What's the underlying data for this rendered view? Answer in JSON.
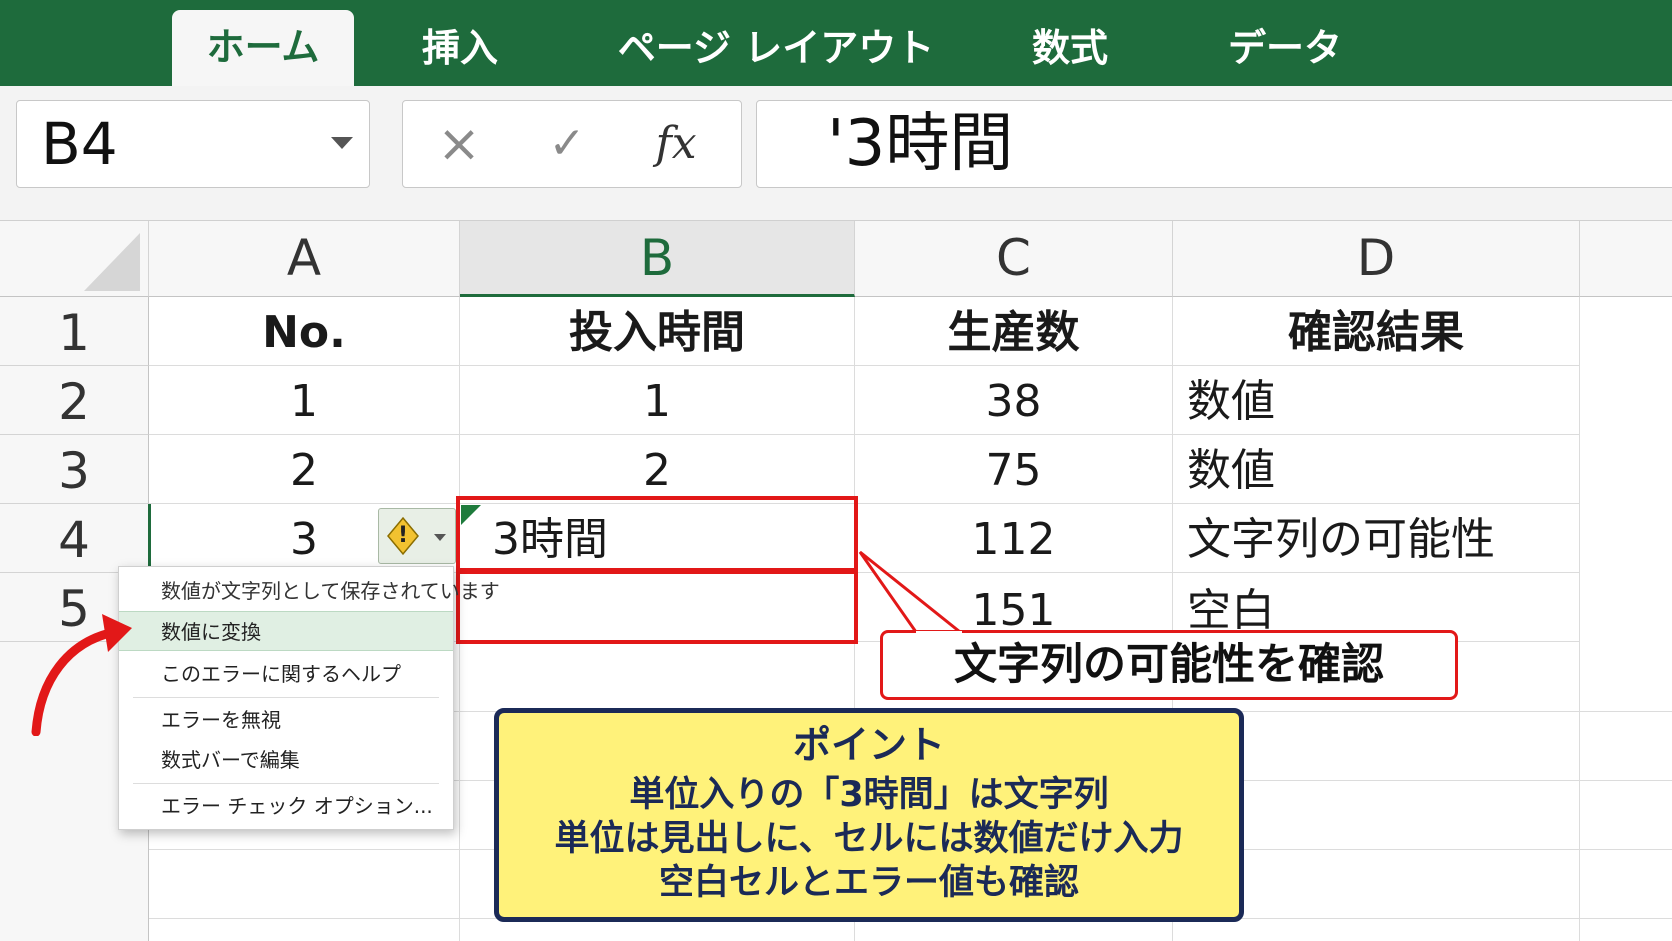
{
  "ribbon": {
    "tabs": [
      {
        "label": "ホーム",
        "active": true
      },
      {
        "label": "挿入",
        "active": false
      },
      {
        "label": "ページ レイアウト",
        "active": false
      },
      {
        "label": "数式",
        "active": false
      },
      {
        "label": "データ",
        "active": false
      }
    ],
    "color": "#1e6b3c"
  },
  "formula_bar": {
    "name_box": "B4",
    "cancel_icon": "×",
    "enter_icon": "✓",
    "fx_icon": "fx",
    "formula": "'3時間"
  },
  "sheet": {
    "columns": [
      "A",
      "B",
      "C",
      "D"
    ],
    "selected_column": "B",
    "rows": [
      "1",
      "2",
      "3",
      "4",
      "5"
    ],
    "header_row": [
      "No.",
      "投入時間",
      "生産数",
      "確認結果"
    ],
    "data": [
      [
        "1",
        "1",
        "38",
        "数値"
      ],
      [
        "2",
        "2",
        "75",
        "数値"
      ],
      [
        "3",
        "3時間",
        "112",
        "文字列の可能性"
      ],
      [
        "",
        "",
        "151",
        "空白"
      ]
    ]
  },
  "error_menu": {
    "items": [
      "数値が文字列として保存されています",
      "数値に変換",
      "このエラーに関するヘルプ",
      "エラーを無視",
      "数式バーで編集",
      "エラー チェック オプション..."
    ],
    "highlighted": "数値に変換",
    "warning_symbol": "!"
  },
  "callout": {
    "text": "文字列の可能性を確認",
    "color": "#e21818"
  },
  "point_box": {
    "title": "ポイント",
    "lines": [
      "単位入りの「3時間」は文字列",
      "単位は見出しに、セルには数値だけ入力",
      "空白セルとエラー値も確認"
    ],
    "background": "#fff27a",
    "border": "#1b2a57"
  }
}
